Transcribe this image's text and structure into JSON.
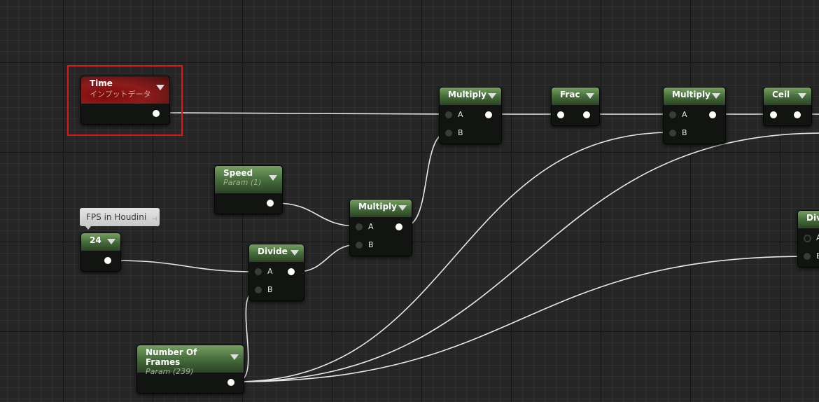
{
  "colors": {
    "selection": "#e0161a",
    "wire": "#e6e6e6",
    "header_green": "#4f7a43",
    "header_red": "#8e1c1c"
  },
  "nodes": {
    "time": {
      "title": "Time",
      "subtitle": "インプットデータ"
    },
    "multiply1": {
      "title": "Multiply",
      "pin_a": "A",
      "pin_b": "B"
    },
    "frac": {
      "title": "Frac"
    },
    "multiply2": {
      "title": "Multiply",
      "pin_a": "A",
      "pin_b": "B"
    },
    "ceil": {
      "title": "Ceil"
    },
    "speed": {
      "title": "Speed",
      "subtitle": "Param (1)"
    },
    "multiply3": {
      "title": "Multiply",
      "pin_a": "A",
      "pin_b": "B"
    },
    "constant24": {
      "title": "24",
      "comment": "FPS in Houdini"
    },
    "divide1": {
      "title": "Divide",
      "pin_a": "A",
      "pin_b": "B"
    },
    "divide2": {
      "title": "Divide",
      "pin_a": "A",
      "pin_b": "B"
    },
    "frames": {
      "title": "Number Of Frames",
      "subtitle": "Param (239)"
    }
  }
}
